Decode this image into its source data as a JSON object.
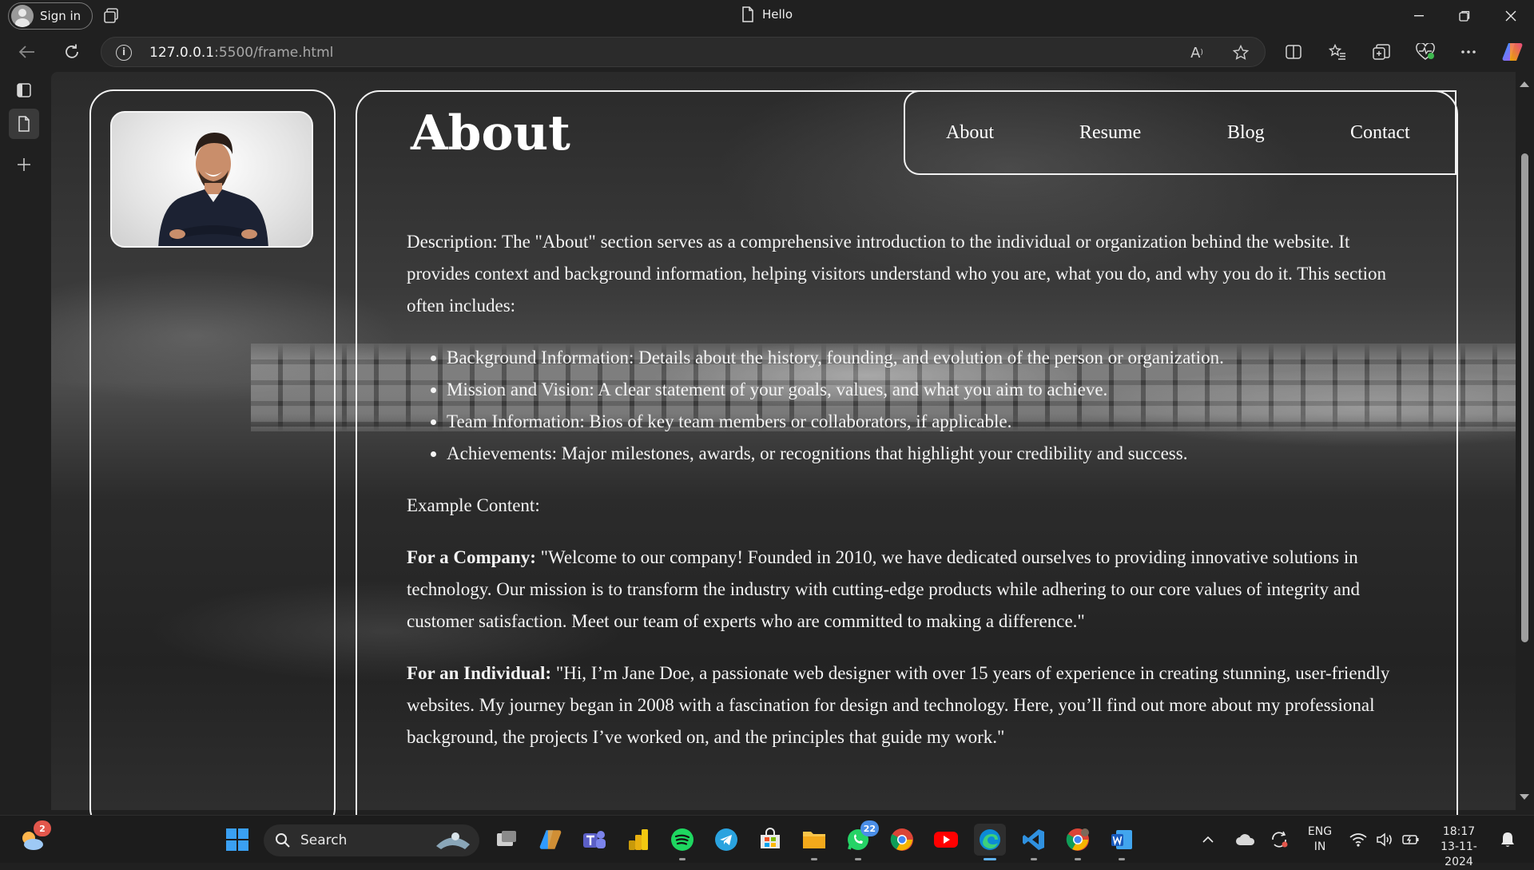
{
  "browser": {
    "signin_label": "Sign in",
    "tab_title": "Hello",
    "url_host": "127.0.0.1",
    "url_path": ":5500/frame.html",
    "window_controls": [
      "minimize-icon",
      "restore-icon",
      "close-icon"
    ],
    "toolbar_icons": [
      "read-aloud-icon",
      "favorite-star-icon",
      "split-screen-icon",
      "favorites-icon",
      "collections-icon",
      "browser-essentials-icon",
      "more-icon",
      "copilot-icon"
    ]
  },
  "page": {
    "title": "About",
    "nav": [
      "About",
      "Resume",
      "Blog",
      "Contact"
    ],
    "description": "Description: The \"About\" section serves as a comprehensive introduction to the individual or organization behind the website. It provides context and background information, helping visitors understand who you are, what you do, and why you do it. This section often includes:",
    "list": [
      "Background Information: Details about the history, founding, and evolution of the person or organization.",
      "Mission and Vision: A clear statement of your goals, values, and what you aim to achieve.",
      "Team Information: Bios of key team members or collaborators, if applicable.",
      "Achievements: Major milestones, awards, or recognitions that highlight your credibility and success."
    ],
    "example_heading": "Example Content:",
    "company_label": "For a Company:",
    "company_text": " \"Welcome to our company! Founded in 2010, we have dedicated ourselves to providing innovative solutions in technology. Our mission is to transform the industry with cutting-edge products while adhering to our core values of integrity and customer satisfaction. Meet our team of experts who are committed to making a difference.\"",
    "individual_label": "For an Individual:",
    "individual_text": " \"Hi, I’m Jane Doe, a passionate web designer with over 15 years of experience in creating stunning, user-friendly websites. My journey began in 2008 with a fascination for design and technology. Here, you’ll find out more about my professional background, the projects I’ve worked on, and the principles that guide my work.\""
  },
  "taskbar": {
    "weather_badge": "2",
    "search_label": "Search",
    "whatsapp_badge": "22",
    "lang_line1": "ENG",
    "lang_line2": "IN",
    "time": "18:17",
    "date": "13-11-2024"
  },
  "colors": {
    "accent": "#5fb3f5",
    "card_border": "#f2f2f2"
  }
}
